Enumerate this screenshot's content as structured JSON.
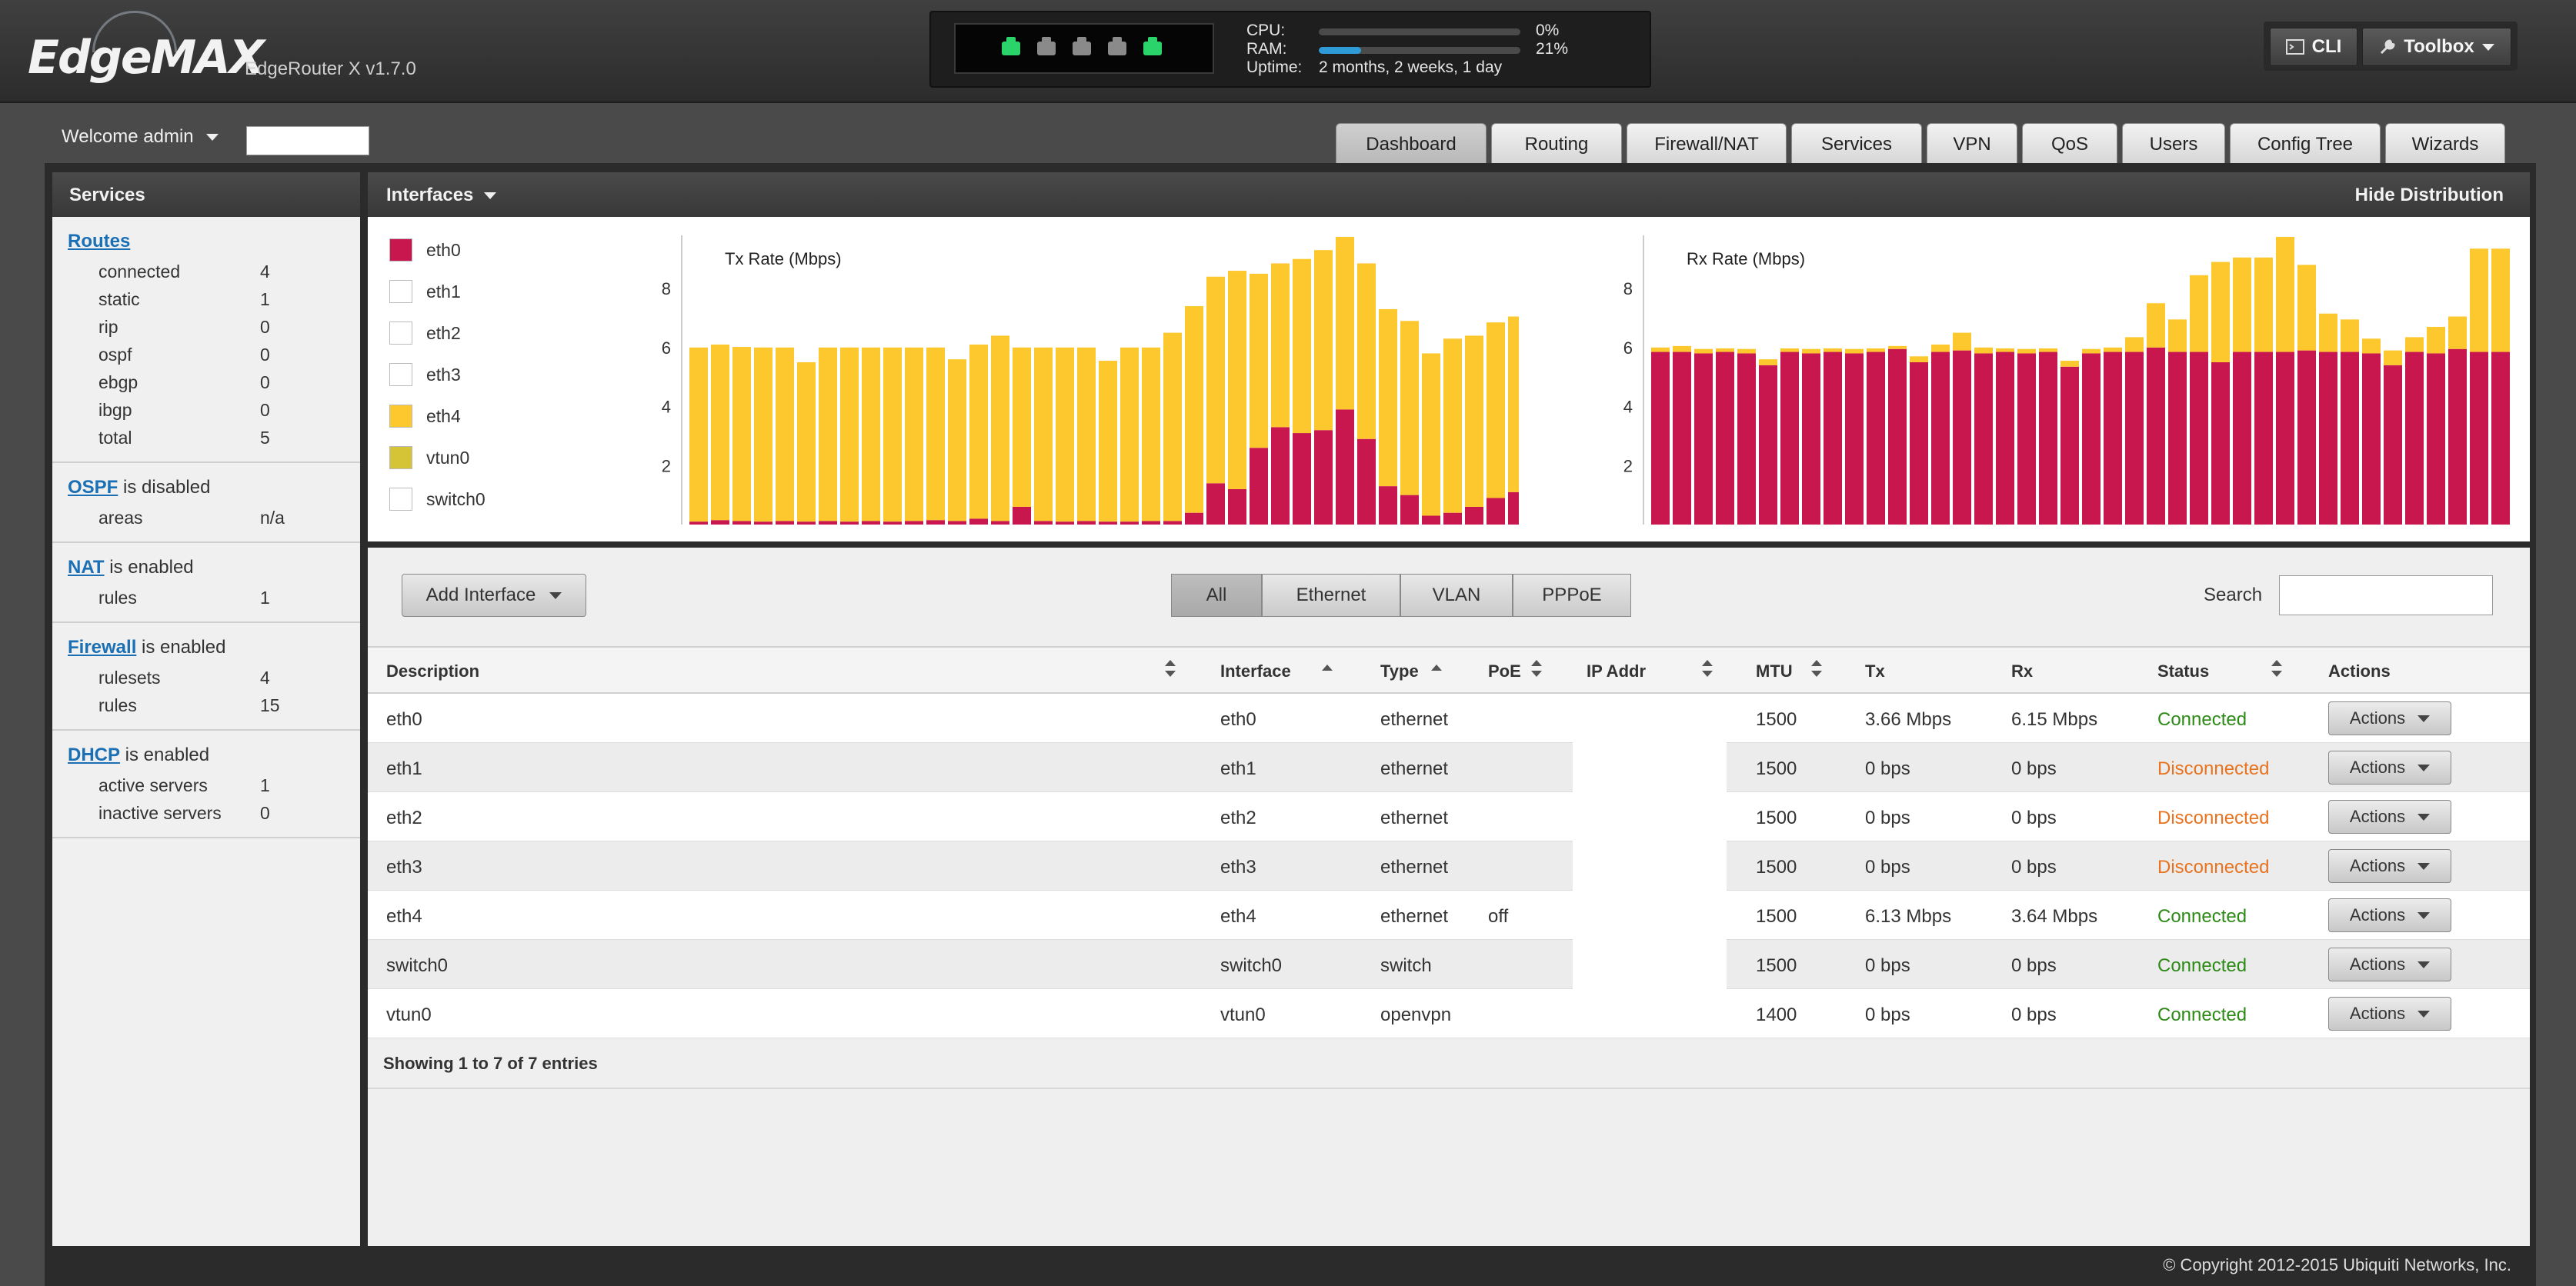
{
  "header": {
    "logo_text": "EdgeMAX",
    "product": "EdgeRouter X v1.7.0",
    "ports": [
      {
        "state": "up",
        "color": "#2bd46a"
      },
      {
        "state": "down",
        "color": "#8a8a8a"
      },
      {
        "state": "down",
        "color": "#8a8a8a"
      },
      {
        "state": "down",
        "color": "#8a8a8a"
      },
      {
        "state": "up",
        "color": "#2bd46a"
      }
    ],
    "cpu_label": "CPU:",
    "cpu_value": "0%",
    "cpu_fraction": 0.0,
    "ram_label": "RAM:",
    "ram_value": "21%",
    "ram_fraction": 0.21,
    "uptime_label": "Uptime:",
    "uptime_value": "2 months, 2 weeks, 1 day",
    "cli_label": "CLI",
    "toolbox_label": "Toolbox"
  },
  "welcome": {
    "text": "Welcome admin"
  },
  "tabs": [
    {
      "label": "Dashboard",
      "active": true
    },
    {
      "label": "Routing"
    },
    {
      "label": "Firewall/NAT"
    },
    {
      "label": "Services"
    },
    {
      "label": "VPN"
    },
    {
      "label": "QoS"
    },
    {
      "label": "Users"
    },
    {
      "label": "Config Tree"
    },
    {
      "label": "Wizards"
    }
  ],
  "sidebar": {
    "title": "Services",
    "routes": {
      "link": "Routes",
      "rows": [
        {
          "k": "connected",
          "v": "4"
        },
        {
          "k": "static",
          "v": "1"
        },
        {
          "k": "rip",
          "v": "0"
        },
        {
          "k": "ospf",
          "v": "0"
        },
        {
          "k": "ebgp",
          "v": "0"
        },
        {
          "k": "ibgp",
          "v": "0"
        },
        {
          "k": "total",
          "v": "5"
        }
      ]
    },
    "ospf": {
      "link": "OSPF",
      "status": " is disabled",
      "rows": [
        {
          "k": "areas",
          "v": "n/a"
        }
      ]
    },
    "nat": {
      "link": "NAT",
      "status": " is enabled",
      "rows": [
        {
          "k": "rules",
          "v": "1"
        }
      ]
    },
    "firewall": {
      "link": "Firewall",
      "status": " is enabled",
      "rows": [
        {
          "k": "rulesets",
          "v": "4"
        },
        {
          "k": "rules",
          "v": "15"
        }
      ]
    },
    "dhcp": {
      "link": "DHCP",
      "status": " is enabled",
      "rows": [
        {
          "k": "active servers",
          "v": "1"
        },
        {
          "k": "inactive servers",
          "v": "0"
        }
      ]
    }
  },
  "interfaces_panel": {
    "title": "Interfaces",
    "hide_label": "Hide Distribution",
    "legend": [
      {
        "name": "eth0",
        "color": "#c8174f"
      },
      {
        "name": "eth1",
        "color": "#ffffff"
      },
      {
        "name": "eth2",
        "color": "#ffffff"
      },
      {
        "name": "eth3",
        "color": "#ffffff"
      },
      {
        "name": "eth4",
        "color": "#fdc72e"
      },
      {
        "name": "vtun0",
        "color": "#d4c436"
      },
      {
        "name": "switch0",
        "color": "#ffffff"
      }
    ]
  },
  "chart_data": [
    {
      "type": "bar",
      "title": "Tx Rate (Mbps)",
      "ylim": [
        0,
        9.8
      ],
      "yticks": [
        2,
        4,
        6,
        8
      ],
      "grid": false,
      "series": [
        {
          "name": "eth0",
          "color": "#c8174f",
          "values": [
            0.1,
            0.15,
            0.12,
            0.1,
            0.12,
            0.1,
            0.12,
            0.1,
            0.12,
            0.1,
            0.12,
            0.15,
            0.12,
            0.2,
            0.12,
            0.6,
            0.12,
            0.1,
            0.12,
            0.1,
            0.1,
            0.12,
            0.12,
            0.4,
            1.4,
            1.2,
            2.6,
            3.3,
            3.1,
            3.2,
            3.9,
            2.9,
            1.3,
            1.0,
            0.3,
            0.4,
            0.6,
            0.9,
            1.1,
            3.5
          ]
        },
        {
          "name": "eth4",
          "color": "#fdc72e",
          "values": [
            5.9,
            5.95,
            5.9,
            5.9,
            5.88,
            5.4,
            5.88,
            5.9,
            5.88,
            5.9,
            5.88,
            5.85,
            5.48,
            5.9,
            6.28,
            5.4,
            5.88,
            5.9,
            5.88,
            5.45,
            5.9,
            5.88,
            6.38,
            7.0,
            7.0,
            7.4,
            5.9,
            5.55,
            5.9,
            6.1,
            5.85,
            5.95,
            6.0,
            5.9,
            5.5,
            5.9,
            5.8,
            5.95,
            5.95,
            5.9
          ]
        }
      ]
    },
    {
      "type": "bar",
      "title": "Rx Rate (Mbps)",
      "ylim": [
        0,
        9.8
      ],
      "yticks": [
        2,
        4,
        6,
        8
      ],
      "grid": false,
      "series": [
        {
          "name": "eth0",
          "color": "#c8174f",
          "values": [
            5.85,
            5.85,
            5.8,
            5.85,
            5.8,
            5.4,
            5.85,
            5.8,
            5.85,
            5.8,
            5.85,
            5.95,
            5.5,
            5.85,
            5.9,
            5.8,
            5.85,
            5.8,
            5.85,
            5.35,
            5.8,
            5.85,
            5.85,
            6.0,
            5.85,
            5.85,
            5.5,
            5.85,
            5.85,
            5.85,
            5.9,
            5.85,
            5.85,
            5.8,
            5.4,
            5.85,
            5.8,
            5.95,
            5.85,
            5.85
          ]
        },
        {
          "name": "eth4",
          "color": "#fdc72e",
          "values": [
            0.15,
            0.2,
            0.15,
            0.12,
            0.15,
            0.2,
            0.12,
            0.15,
            0.12,
            0.15,
            0.12,
            0.1,
            0.2,
            0.25,
            0.6,
            0.2,
            0.12,
            0.15,
            0.12,
            0.2,
            0.15,
            0.15,
            0.5,
            1.5,
            1.1,
            2.6,
            3.4,
            3.2,
            3.2,
            3.9,
            2.9,
            1.3,
            1.1,
            0.5,
            0.5,
            0.5,
            0.9,
            1.1,
            3.5,
            3.5
          ]
        }
      ]
    }
  ],
  "toolbar": {
    "add_label": "Add Interface",
    "filters": [
      {
        "label": "All",
        "active": true
      },
      {
        "label": "Ethernet"
      },
      {
        "label": "VLAN"
      },
      {
        "label": "PPPoE"
      }
    ],
    "search_label": "Search"
  },
  "table": {
    "headers": {
      "description": "Description",
      "interface": "Interface",
      "type": "Type",
      "poe": "PoE",
      "ip": "IP Addr",
      "mtu": "MTU",
      "tx": "Tx",
      "rx": "Rx",
      "status": "Status",
      "actions": "Actions"
    },
    "rows": [
      {
        "description": "eth0",
        "interface": "eth0",
        "type": "ethernet",
        "poe": "",
        "mtu": "1500",
        "tx": "3.66 Mbps",
        "rx": "6.15 Mbps",
        "status": "Connected",
        "ok": true,
        "action": "Actions"
      },
      {
        "description": "eth1",
        "interface": "eth1",
        "type": "ethernet",
        "poe": "",
        "mtu": "1500",
        "tx": "0 bps",
        "rx": "0 bps",
        "status": "Disconnected",
        "ok": false,
        "action": "Actions"
      },
      {
        "description": "eth2",
        "interface": "eth2",
        "type": "ethernet",
        "poe": "",
        "mtu": "1500",
        "tx": "0 bps",
        "rx": "0 bps",
        "status": "Disconnected",
        "ok": false,
        "action": "Actions"
      },
      {
        "description": "eth3",
        "interface": "eth3",
        "type": "ethernet",
        "poe": "",
        "mtu": "1500",
        "tx": "0 bps",
        "rx": "0 bps",
        "status": "Disconnected",
        "ok": false,
        "action": "Actions"
      },
      {
        "description": "eth4",
        "interface": "eth4",
        "type": "ethernet",
        "poe": "off",
        "mtu": "1500",
        "tx": "6.13 Mbps",
        "rx": "3.64 Mbps",
        "status": "Connected",
        "ok": true,
        "action": "Actions"
      },
      {
        "description": "switch0",
        "interface": "switch0",
        "type": "switch",
        "poe": "",
        "mtu": "1500",
        "tx": "0 bps",
        "rx": "0 bps",
        "status": "Connected",
        "ok": true,
        "action": "Actions"
      },
      {
        "description": "vtun0",
        "interface": "vtun0",
        "type": "openvpn",
        "poe": "",
        "mtu": "1400",
        "tx": "0 bps",
        "rx": "0 bps",
        "status": "Connected",
        "ok": true,
        "action": "Actions"
      }
    ],
    "footer": "Showing 1 to 7 of 7 entries"
  },
  "copyright": "© Copyright 2012-2015 Ubiquiti Networks, Inc."
}
